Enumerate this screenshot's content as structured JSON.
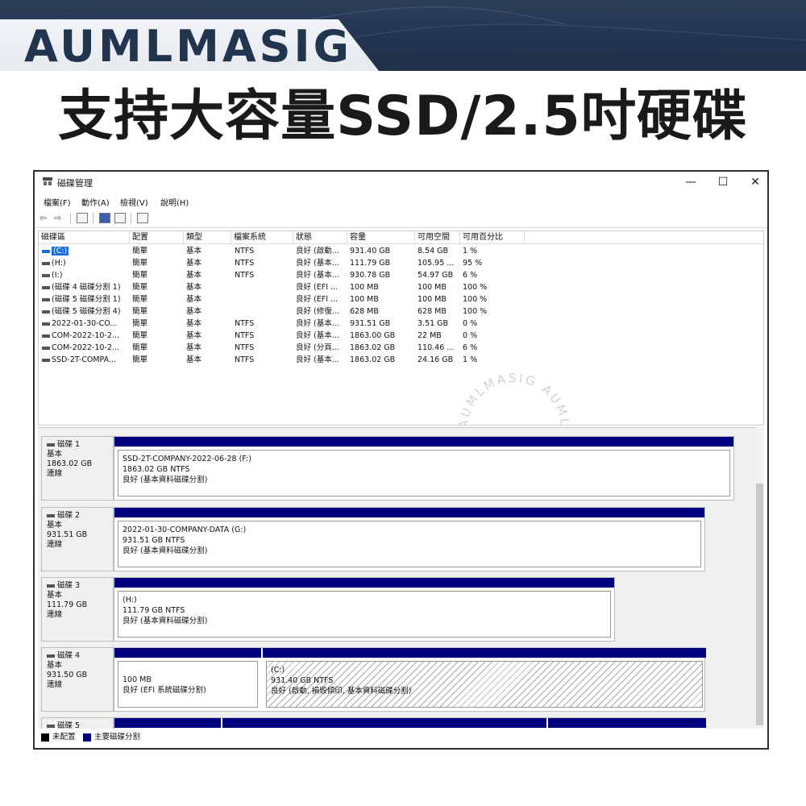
{
  "banner": {
    "brand": "AUMLMASIG",
    "headline": "支持大容量SSD/2.5吋硬碟"
  },
  "window": {
    "title": "磁碟管理",
    "controls": {
      "minimize": "—",
      "maximize": "☐",
      "close": "✕"
    },
    "menu": [
      "檔案(F)",
      "動作(A)",
      "檢視(V)",
      "說明(H)"
    ]
  },
  "volumes": {
    "headers": [
      "磁碟區",
      "配置",
      "類型",
      "檔案系統",
      "狀態",
      "容量",
      "可用空間",
      "可用百分比"
    ],
    "rows": [
      [
        "(C:)",
        "簡單",
        "基本",
        "NTFS",
        "良好 (啟動...",
        "931.40 GB",
        "8.54 GB",
        "1 %"
      ],
      [
        "(H:)",
        "簡單",
        "基本",
        "NTFS",
        "良好 (基本...",
        "111.79 GB",
        "105.95 ...",
        "95 %"
      ],
      [
        "(I:)",
        "簡單",
        "基本",
        "NTFS",
        "良好 (基本...",
        "930.78 GB",
        "54.97 GB",
        "6 %"
      ],
      [
        "(磁碟 4 磁碟分割 1)",
        "簡單",
        "基本",
        "",
        "良好 (EFI ...",
        "100 MB",
        "100 MB",
        "100 %"
      ],
      [
        "(磁碟 5 磁碟分割 1)",
        "簡單",
        "基本",
        "",
        "良好 (EFI ...",
        "100 MB",
        "100 MB",
        "100 %"
      ],
      [
        "(磁碟 5 磁碟分割 4)",
        "簡單",
        "基本",
        "",
        "良好 (修復...",
        "628 MB",
        "628 MB",
        "100 %"
      ],
      [
        "2022-01-30-CO...",
        "簡單",
        "基本",
        "NTFS",
        "良好 (基本...",
        "931.51 GB",
        "3.51 GB",
        "0 %"
      ],
      [
        "COM-2022-10-2...",
        "簡單",
        "基本",
        "NTFS",
        "良好 (基本...",
        "1863.00 GB",
        "22 MB",
        "0 %"
      ],
      [
        "COM-2022-10-2...",
        "簡單",
        "基本",
        "NTFS",
        "良好 (分頁...",
        "1863.02 GB",
        "110.46 ...",
        "6 %"
      ],
      [
        "SSD-2T-COMPA...",
        "簡單",
        "基本",
        "NTFS",
        "良好 (基本...",
        "1863.02 GB",
        "24.16 GB",
        "1 %"
      ]
    ]
  },
  "disks": [
    {
      "name": "磁碟 1",
      "type": "基本",
      "size": "1863.02 GB",
      "status": "連線",
      "partitions": [
        {
          "line1": "SSD-2T-COMPANY-2022-06-28  (F:)",
          "line2": "1863.02 GB NTFS",
          "line3": "良好 (基本資料磁碟分割)"
        }
      ]
    },
    {
      "name": "磁碟 2",
      "type": "基本",
      "size": "931.51 GB",
      "status": "連線",
      "partitions": [
        {
          "line1": "2022-01-30-COMPANY-DATA  (G:)",
          "line2": "931.51 GB NTFS",
          "line3": "良好 (基本資料磁碟分割)"
        }
      ]
    },
    {
      "name": "磁碟 3",
      "type": "基本",
      "size": "111.79 GB",
      "status": "連線",
      "partitions": [
        {
          "line1": "  (H:)",
          "line2": "111.79 GB NTFS",
          "line3": "良好 (基本資料磁碟分割)"
        }
      ]
    },
    {
      "name": "磁碟 4",
      "type": "基本",
      "size": "931.50 GB",
      "status": "連線",
      "partitions": [
        {
          "line1": "",
          "line2": "100 MB",
          "line3": "良好 (EFI 系統磁碟分割)"
        },
        {
          "line1": "(C:)",
          "line2": "931.40 GB NTFS",
          "line3": "良好 (啟動, 損毀傾印, 基本資料磁碟分割)"
        }
      ]
    },
    {
      "name": "磁碟 5"
    }
  ],
  "legend": {
    "unallocated": "未配置",
    "primary": "主要磁碟分割"
  },
  "watermark": "AUMLMASIG AUMLMASIG",
  "colors": {
    "partition_bar": "#00007f",
    "banner": "#223550",
    "selection": "#1f6fd6"
  }
}
